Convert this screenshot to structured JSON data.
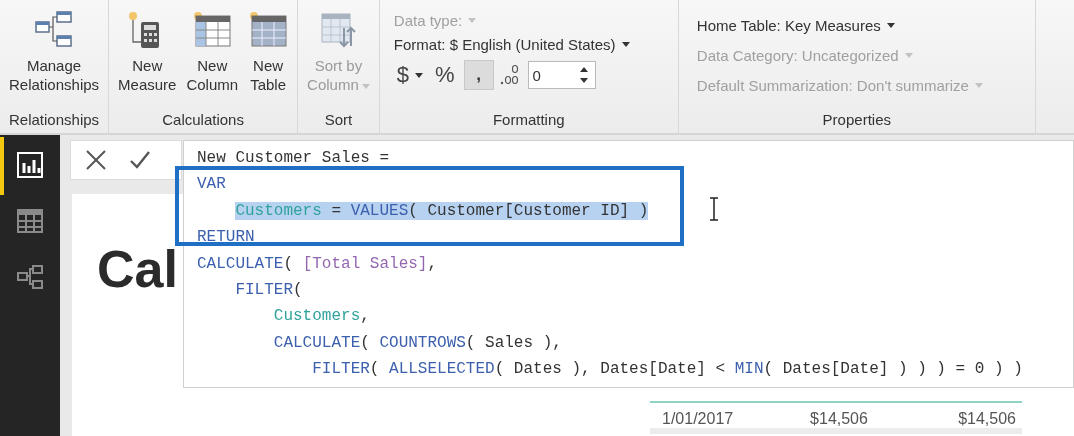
{
  "ribbon": {
    "groups": [
      {
        "label": "Relationships",
        "kind": "buttons",
        "buttons": [
          {
            "label": "Manage\nRelationships",
            "disabled": false
          }
        ]
      },
      {
        "label": "Calculations",
        "kind": "buttons",
        "buttons": [
          {
            "label": "New\nMeasure",
            "disabled": false
          },
          {
            "label": "New\nColumn",
            "disabled": false
          },
          {
            "label": "New\nTable",
            "disabled": false
          }
        ]
      },
      {
        "label": "Sort",
        "kind": "buttons",
        "buttons": [
          {
            "label": "Sort by\nColumn",
            "disabled": true
          }
        ]
      },
      {
        "label": "Formatting",
        "kind": "formatting",
        "data_type": {
          "label": "Data type:",
          "disabled": true
        },
        "format": {
          "label": "Format: $ English (United States)",
          "disabled": false
        },
        "currency": "$",
        "percent": "%",
        "comma": {
          "label": ",",
          "selected": true
        },
        "decimals": "0"
      },
      {
        "label": "Properties",
        "kind": "properties",
        "items": [
          {
            "label": "Home Table: Key Measures",
            "disabled": false
          },
          {
            "label": "Data Category: Uncategorized",
            "disabled": true
          },
          {
            "label": "Default Summarization: Don't summarize",
            "disabled": true
          }
        ]
      }
    ]
  },
  "sidebar": {
    "items": [
      {
        "selected": true
      },
      {
        "selected": false
      },
      {
        "selected": false
      }
    ]
  },
  "formula_editor": {
    "lines": [
      {
        "selected": false,
        "tokens": [
          {
            "text": "New Customer Sales =",
            "kind": "plain"
          }
        ]
      },
      {
        "selected": false,
        "tokens": [
          {
            "text": "VAR",
            "kind": "keyword"
          }
        ]
      },
      {
        "selected": true,
        "tokens": [
          {
            "text": "    Customers",
            "kind": "variable"
          },
          {
            "text": " = ",
            "kind": "plain"
          },
          {
            "text": "VALUES",
            "kind": "keyword"
          },
          {
            "text": "( Customer[Customer ID] )",
            "kind": "plain"
          }
        ]
      },
      {
        "selected": false,
        "tokens": [
          {
            "text": "RETURN",
            "kind": "keyword"
          }
        ]
      },
      {
        "selected": false,
        "tokens": [
          {
            "text": "CALCULATE",
            "kind": "keyword"
          },
          {
            "text": "( ",
            "kind": "plain"
          },
          {
            "text": "[Total Sales]",
            "kind": "measure"
          },
          {
            "text": ",",
            "kind": "plain"
          }
        ]
      },
      {
        "selected": false,
        "tokens": [
          {
            "text": "    FILTER",
            "kind": "keyword"
          },
          {
            "text": "(",
            "kind": "plain"
          }
        ]
      },
      {
        "selected": false,
        "tokens": [
          {
            "text": "        Customers",
            "kind": "variable"
          },
          {
            "text": ",",
            "kind": "plain"
          }
        ]
      },
      {
        "selected": false,
        "tokens": [
          {
            "text": "        CALCULATE",
            "kind": "keyword"
          },
          {
            "text": "( ",
            "kind": "plain"
          },
          {
            "text": "COUNTROWS",
            "kind": "keyword"
          },
          {
            "text": "( Sales ),",
            "kind": "plain"
          }
        ]
      },
      {
        "selected": false,
        "tokens": [
          {
            "text": "            FILTER",
            "kind": "keyword"
          },
          {
            "text": "( ",
            "kind": "plain"
          },
          {
            "text": "ALLSELECTED",
            "kind": "keyword"
          },
          {
            "text": "( Dates ), Dates[Date] < ",
            "kind": "plain"
          },
          {
            "text": "MIN",
            "kind": "keyword"
          },
          {
            "text": "( Dates[Date] ) ) ) = 0 ) )",
            "kind": "plain"
          }
        ]
      }
    ]
  },
  "canvas": {
    "title": "Cal",
    "table": {
      "rows": [
        [
          "1/01/2017",
          "$14,506",
          "$14,506"
        ]
      ]
    }
  }
}
